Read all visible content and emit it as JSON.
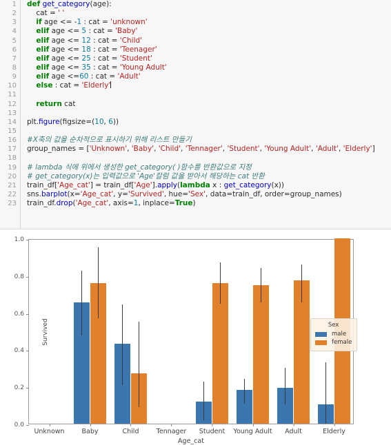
{
  "code_cell": {
    "line_numbers": [
      1,
      2,
      3,
      4,
      5,
      6,
      7,
      8,
      9,
      10,
      11,
      12,
      13,
      14,
      15,
      16,
      17,
      18,
      19,
      20,
      21,
      22,
      23
    ],
    "lines": [
      "def get_category(age):",
      "    cat = ' '",
      "    if age <= -1 : cat = 'unknown'",
      "    elif age <= 5 : cat = 'Baby'",
      "    elif age <= 12 : cat = 'Child'",
      "    elif age <= 18 : cat = 'Teenager'",
      "    elif age <= 25 : cat = 'Student'",
      "    elif age <= 35 : cat = 'Young Adult'",
      "    elif age <=60 : cat = 'Adult'",
      "    else : cat = 'Elderly'",
      "",
      "    return cat",
      "",
      "plt.figure(figsize=(10, 6))",
      "",
      "#X축의 값을 순차적으로 표시하기 위해 리스트 만들기",
      "group_names = ['Unknown', 'Baby', 'Child', 'Tennager', 'Student', 'Young Adult', 'Adult', 'Elderly']",
      "",
      "# lambda 식에 위에서 생성한 get_category( )함수를 반환값으로 지정",
      "# get_category(x)는 입력값으로 'Age'칼럼 값을 받아서 해당하는 cat 반환",
      "train_df['Age_cat'] = train_df['Age'].apply(lambda x : get_category(x))",
      "sns.barplot(x='Age_cat', y='Survived', hue='Sex', data=train_df, order=group_names)",
      "train_df.drop('Age_cat', axis=1, inplace=True)"
    ],
    "tokens": {
      "def": "def",
      "func_name": "get_category",
      "arg_age": "(age):",
      "cat_assign": "cat = ",
      "empty_str": "' '",
      "if": "if",
      "elif": "elif",
      "else": "else",
      "return": "return",
      "lambda": "lambda",
      "true": "True"
    }
  },
  "chart_data": {
    "type": "bar",
    "title": "",
    "xlabel": "Age_cat",
    "ylabel": "Survived",
    "categories": [
      "Unknown",
      "Baby",
      "Child",
      "Tennager",
      "Student",
      "Young Adult",
      "Adult",
      "Elderly"
    ],
    "ylim": [
      0.0,
      1.0
    ],
    "yticks": [
      "0.0",
      "0.2",
      "0.4",
      "0.6",
      "0.8",
      "1.0"
    ],
    "ytick_values": [
      0.0,
      0.2,
      0.4,
      0.6,
      0.8,
      1.0
    ],
    "grid": false,
    "legend": {
      "title": "Sex",
      "position": "center-right",
      "entries": [
        {
          "label": "male",
          "color": "#3b76af"
        },
        {
          "label": "female",
          "color": "#e1812c"
        }
      ]
    },
    "series": [
      {
        "name": "male",
        "color": "#3b76af",
        "values": [
          null,
          0.655,
          0.43,
          null,
          0.12,
          0.183,
          0.195,
          0.105
        ],
        "ci_lower": [
          null,
          0.475,
          0.21,
          null,
          0.02,
          0.107,
          0.105,
          0.0
        ],
        "ci_upper": [
          null,
          0.825,
          0.645,
          null,
          0.228,
          0.243,
          0.3,
          0.33
        ]
      },
      {
        "name": "female",
        "color": "#e1812c",
        "values": [
          null,
          0.76,
          0.272,
          null,
          0.758,
          0.748,
          0.772,
          1.0
        ],
        "ci_lower": [
          null,
          0.57,
          0.09,
          null,
          0.648,
          0.655,
          0.655,
          null
        ],
        "ci_upper": [
          null,
          0.95,
          0.55,
          null,
          0.87,
          0.84,
          0.86,
          null
        ]
      }
    ]
  }
}
